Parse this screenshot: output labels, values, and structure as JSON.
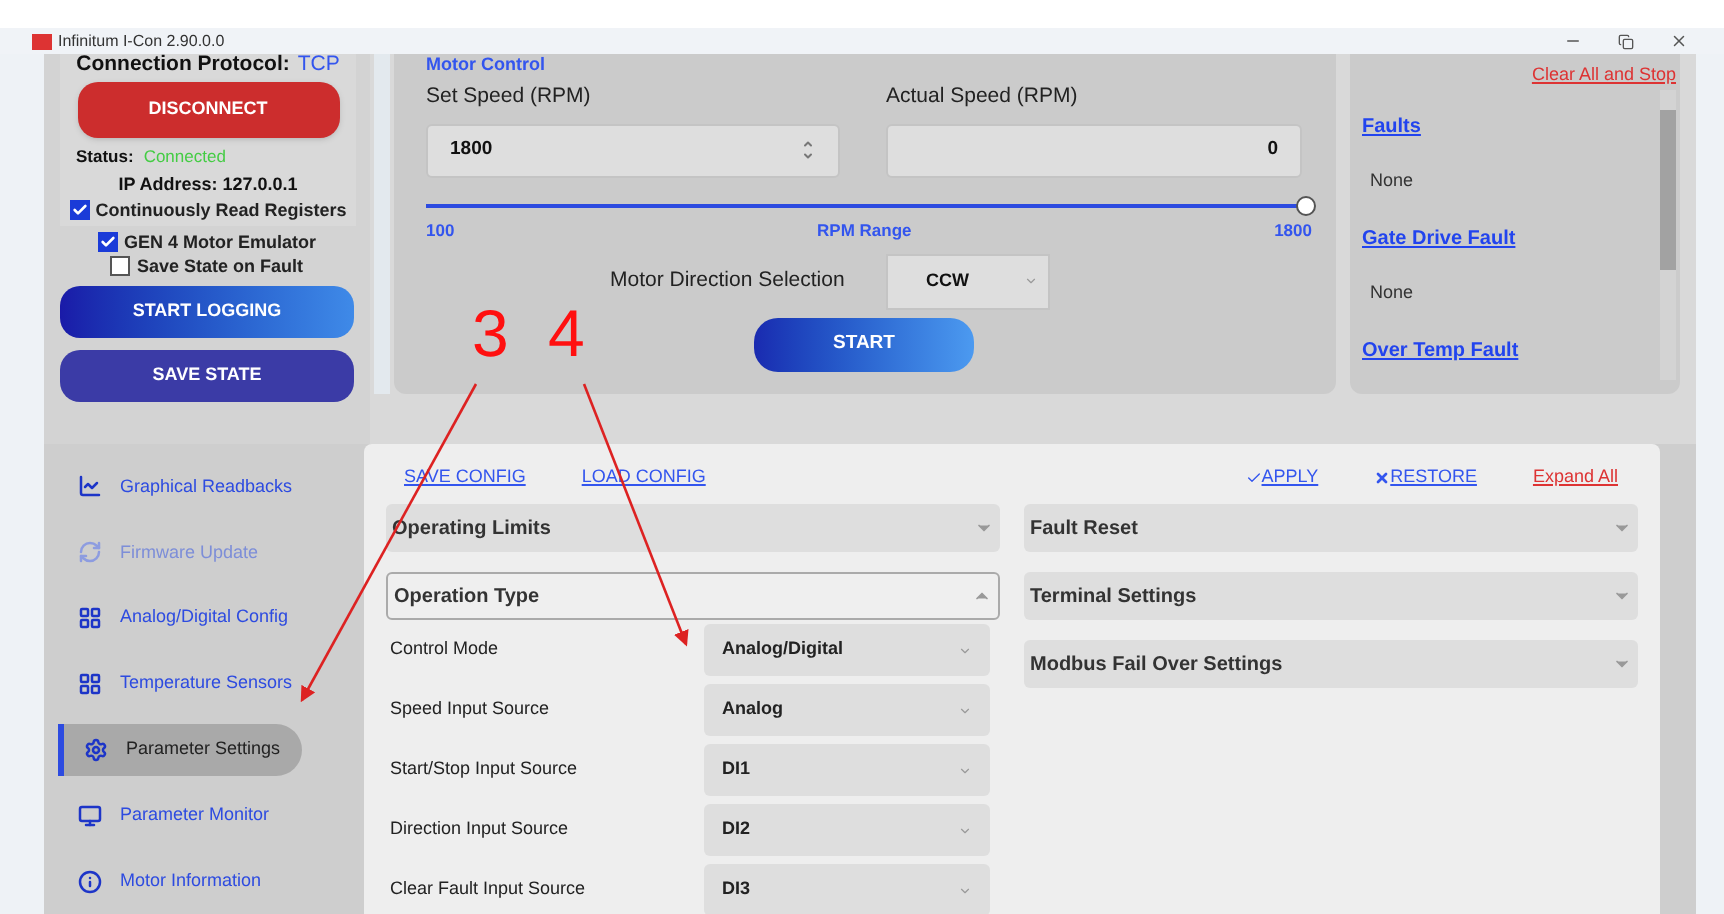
{
  "window": {
    "title": "Infinitum I-Con 2.90.0.0"
  },
  "connection": {
    "protocol_label": "Connection Protocol:",
    "protocol": "TCP",
    "disconnect_button": "DISCONNECT",
    "status_label": "Status:",
    "status": "Connected",
    "ip_address": "IP Address: 127.0.0.1"
  },
  "checkboxes": [
    {
      "label": "Continuously Read Registers",
      "checked": true
    },
    {
      "label": "GEN 4 Motor Emulator",
      "checked": true
    },
    {
      "label": "Save State on Fault",
      "checked": false
    }
  ],
  "buttons": [
    "START LOGGING",
    "SAVE STATE"
  ],
  "motor_control": {
    "title": "Motor Control",
    "set_speed_label": "Set Speed (RPM)",
    "set_speed": "1800",
    "actual_speed_label": "Actual Speed (RPM)",
    "actual_speed": "0",
    "range_min": "100",
    "range_label": "RPM Range",
    "range_max": "1800",
    "level": 1,
    "direction_label": "Motor Direction Selection",
    "direction": "CCW",
    "start_button": "START"
  },
  "faults": {
    "clear_link": "Clear All and Stop",
    "items": [
      {
        "title": "Faults",
        "value": "None"
      },
      {
        "title": "Gate Drive Fault",
        "value": "None"
      },
      {
        "title": "Over Temp Fault"
      }
    ]
  },
  "nav": [
    {
      "label": "Graphical Readbacks",
      "disabled": false,
      "selected": false
    },
    {
      "label": "Firmware Update",
      "disabled": true,
      "selected": false
    },
    {
      "label": "Analog/Digital Config",
      "disabled": false,
      "selected": false
    },
    {
      "label": "Temperature Sensors",
      "disabled": false,
      "selected": false
    },
    {
      "label": "Parameter Settings",
      "disabled": false,
      "selected": true
    },
    {
      "label": "Parameter Monitor",
      "disabled": false,
      "selected": false
    },
    {
      "label": "Motor Information",
      "disabled": false,
      "selected": false
    }
  ],
  "config": {
    "save_link": "SAVE CONFIG",
    "load_link": "LOAD CONFIG",
    "apply_link": "APPLY",
    "restore_link": "RESTORE",
    "expand_all_link": "Expand All",
    "left_sections": [
      {
        "title": "Operating Limits",
        "expanded": false
      },
      {
        "title": "Operation Type",
        "expanded": true,
        "fields": [
          {
            "label": "Control Mode",
            "value": "Analog/Digital"
          },
          {
            "label": "Speed Input Source",
            "value": "Analog"
          },
          {
            "label": "Start/Stop Input Source",
            "value": "DI1"
          },
          {
            "label": "Direction Input Source",
            "value": "DI2"
          },
          {
            "label": "Clear Fault Input Source",
            "value": "DI3"
          }
        ]
      }
    ],
    "right_sections": [
      {
        "title": "Fault Reset",
        "expanded": false
      },
      {
        "title": "Terminal Settings",
        "expanded": false
      },
      {
        "title": "Modbus Fail Over Settings",
        "expanded": false
      }
    ]
  },
  "annotations": [
    {
      "text": "3"
    },
    {
      "text": "4"
    }
  ]
}
